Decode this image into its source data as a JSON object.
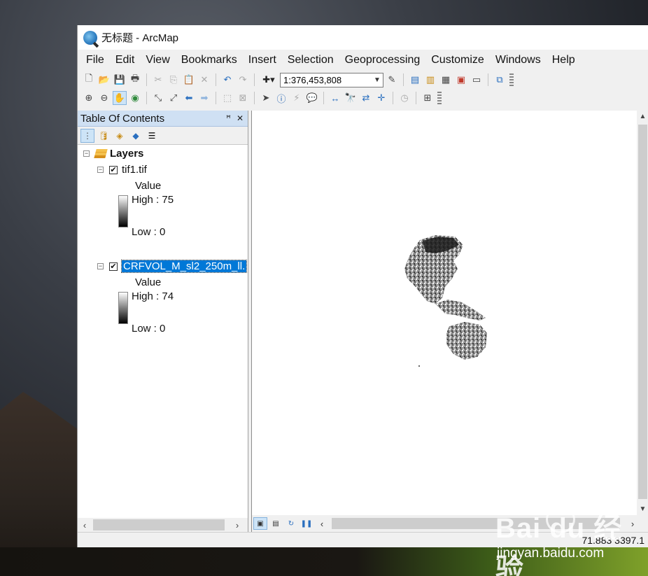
{
  "window": {
    "title": "无标题 - ArcMap"
  },
  "menu": [
    "File",
    "Edit",
    "View",
    "Bookmarks",
    "Insert",
    "Selection",
    "Geoprocessing",
    "Customize",
    "Windows",
    "Help"
  ],
  "toolbar": {
    "scale": "1:376,453,808"
  },
  "toc": {
    "title": "Table Of Contents",
    "pin": "ꟸ",
    "close": "✕",
    "root": "Layers",
    "layers": [
      {
        "name": "tif1.tif",
        "checked": "✔",
        "field": "Value",
        "high": "High : 75",
        "low": "Low : 0"
      },
      {
        "name": "CRFVOL_M_sl2_250m_ll.",
        "checked": "✔",
        "field": "Value",
        "high": "High : 74",
        "low": "Low : 0"
      }
    ]
  },
  "status": {
    "coords": "71.883  3397.1"
  },
  "watermark": {
    "brand": "Bai  du 经验",
    "site": "jingyan.baidu.com"
  },
  "colors": {
    "toc_header": "#cfe0f3",
    "selection": "#0078d7"
  }
}
